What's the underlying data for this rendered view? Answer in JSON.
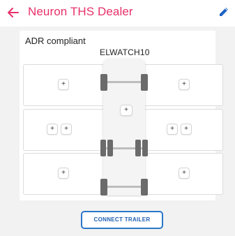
{
  "header": {
    "title": "Neuron THS Dealer"
  },
  "vehicle": {
    "adr_label": "ADR compliant",
    "name": "ELWATCH10"
  },
  "axle_buttons": {
    "add_label": "+"
  },
  "actions": {
    "connect_trailer": "CONNECT TRAILER"
  },
  "colors": {
    "accent": "#e8306a",
    "button_border": "#2b76c9",
    "tire": "#6b6b6b"
  }
}
